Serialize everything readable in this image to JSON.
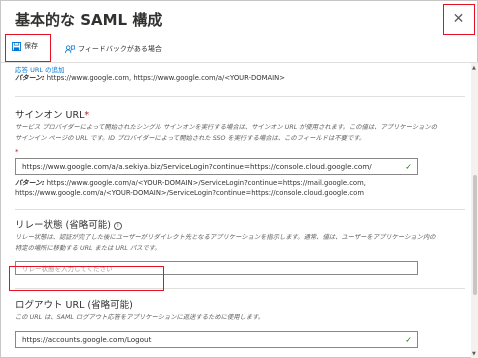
{
  "panel": {
    "title": "基本的な SAML 構成",
    "close_glyph": "✕"
  },
  "toolbar": {
    "save_label": "保存",
    "feedback_label": "フィードバックがある場合"
  },
  "reply_url": {
    "add_link": "応答 URL の追加",
    "pattern_label": "パターン:",
    "pattern_text": " https://www.google.com, https://www.google.com/a/<YOUR-DOMAIN>"
  },
  "sign_on_url": {
    "label": "サインオン URL",
    "required_mark": "*",
    "description_line1": "サービス プロバイダーによって開始されたシングル サインオンを実行する場合は、サインオン URL が使用されます。この値は、アプリケーションの",
    "description_line2": "サインイン ページの URL です。ID プロバイダーによって開始された SSO を実行する場合は、このフィールドは不要です。",
    "field_required_mark": "*",
    "value": "https://www.google.com/a/a.sekiya.biz/ServiceLogin?continue=https://console.cloud.google.com/",
    "pattern_label": "パターン:",
    "pattern_line1": " https://www.google.com/a/<YOUR-DOMAIN>/ServiceLogin?continue=https://mail.google.com,",
    "pattern_line2": "https://www.google.com/a/<YOUR-DOMAIN>/ServiceLogin?continue=https://console.cloud.google.com"
  },
  "relay_state": {
    "label": "リレー状態 (省略可能)",
    "info_glyph": "i",
    "description_line1": "リレー状態は、認証が完了した後にユーザーがリダイレクト先となるアプリケーションを指示します。通常、値は、ユーザーをアプリケーション内の",
    "description_line2": "特定の場所に移動する URL または URL パスです。",
    "placeholder": "リレー状態を入力してください"
  },
  "logout_url": {
    "label": "ログアウト URL (省略可能)",
    "description": "この URL は、SAML ログアウト応答をアプリケーションに返送するために使用します。",
    "value": "https://accounts.google.com/Logout"
  },
  "icons": {
    "check_glyph": "✓",
    "scroll_up_glyph": "▲",
    "scroll_down_glyph": "▼"
  },
  "colors": {
    "accent": "#0078d4",
    "highlight_box": "#e81123",
    "valid_check": "#107c10",
    "required": "#a4262c"
  }
}
